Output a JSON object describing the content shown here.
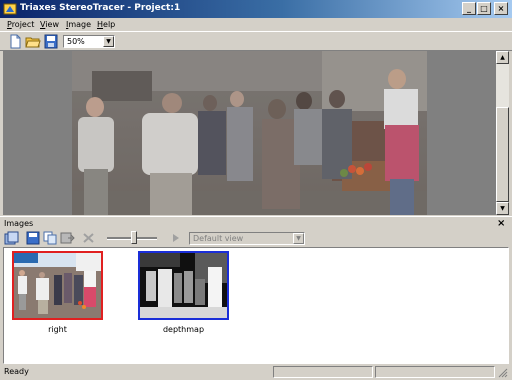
{
  "window": {
    "title": "Triaxes StereoTracer - Project:1",
    "buttons": {
      "minimize": "_",
      "maximize": "□",
      "close": "×"
    }
  },
  "menu": [
    "Project",
    "View",
    "Image",
    "Help"
  ],
  "toolbar": {
    "icons": [
      "new-project-icon",
      "open-project-icon",
      "save-project-icon"
    ],
    "zoom": "50%"
  },
  "images_panel": {
    "title": "Images",
    "close": "×",
    "view_select": "Default view",
    "tools": [
      "add-image-icon",
      "save-image-icon",
      "copy-image-icon",
      "export-image-icon",
      "delete-icon",
      "play-icon"
    ],
    "thumbnails": [
      {
        "label": "right",
        "border_color": "#e02020"
      },
      {
        "label": "depthmap",
        "border_color": "#1a2ed8"
      }
    ]
  },
  "status": {
    "text": "Ready"
  }
}
